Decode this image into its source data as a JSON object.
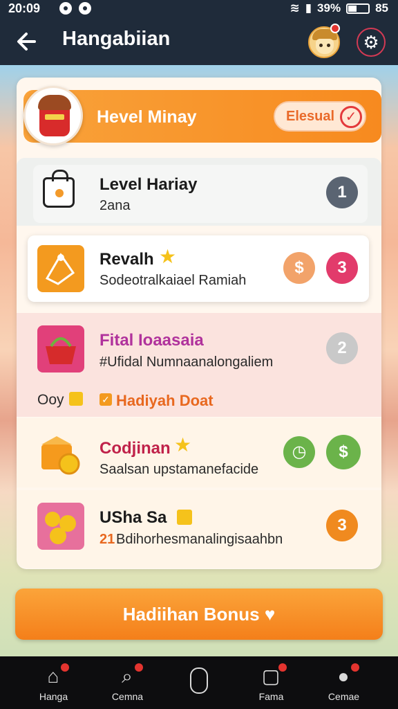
{
  "status_bar": {
    "time": "20:09",
    "battery": "39%",
    "signal_label": "85"
  },
  "header": {
    "title": "Hangabiian"
  },
  "banner": {
    "title": "Hevel Minay",
    "pill_label": "Elesual"
  },
  "rows": [
    {
      "name": "Level Hariay",
      "sub": "2ana",
      "badge": "1",
      "badge_color": "#5a6472"
    },
    {
      "name": "Revalh",
      "sub": "Sodeotralkaiael Ramiah",
      "badge": "3",
      "badge_color": "#e23b6b",
      "coin_color": "#f2a36a"
    },
    {
      "name": "Fital Ioaasaia",
      "sub": "#Ufidal Numnaanalongaliem",
      "badge": "2",
      "badge_color": "#c9c9c9",
      "extra_left": "Ooy",
      "extra_right": "Hadiyah Doat"
    },
    {
      "name": "Codjinan",
      "sub": "Saalsan upstamanefacide",
      "badge_color": "#6bb34a"
    },
    {
      "name": "USha Sa",
      "sub": "Bdihorhesmanalingisaahbn",
      "sub_prefix": "21",
      "badge": "3",
      "badge_color": "#f08a1f"
    }
  ],
  "bonus_button": {
    "label": "Hadiihan Bonus"
  },
  "nav": [
    {
      "label": "Hanga",
      "icon": "home-icon"
    },
    {
      "label": "Cemna",
      "icon": "search-icon"
    },
    {
      "label": "",
      "icon": "mouse-icon"
    },
    {
      "label": "Fama",
      "icon": "inbox-icon"
    },
    {
      "label": "Cemae",
      "icon": "profile-icon"
    }
  ]
}
